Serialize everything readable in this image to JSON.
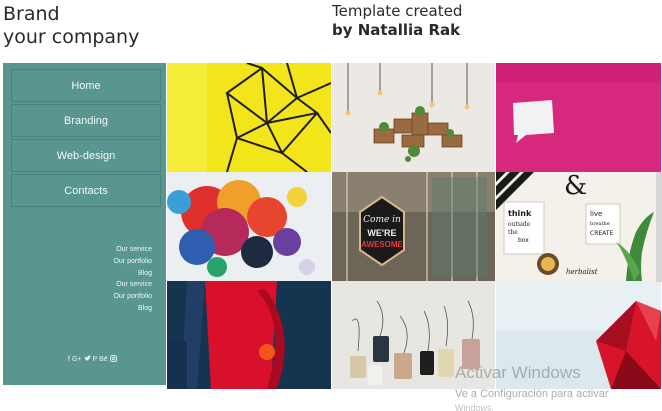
{
  "header": {
    "brand_line1": "Brand",
    "brand_line2": "your company",
    "credit_line1": "Template created",
    "credit_line2": "by Natallia Rak"
  },
  "sidebar": {
    "bg_color": "#5a9690",
    "nav": [
      "Home",
      "Branding",
      "Web-design",
      "Contacts"
    ],
    "links": [
      "Our service",
      "Our portfolio",
      "Blog",
      "Our service",
      "Our portfolio",
      "Blog"
    ],
    "social_icons": [
      {
        "name": "facebook-icon",
        "glyph": "f"
      },
      {
        "name": "google-plus-icon",
        "glyph": "G+"
      },
      {
        "name": "twitter-icon",
        "glyph": "🐦"
      },
      {
        "name": "pinterest-icon",
        "glyph": "P"
      },
      {
        "name": "behance-icon",
        "glyph": "Bē"
      },
      {
        "name": "instagram-icon",
        "glyph": "◎"
      }
    ]
  },
  "gallery": {
    "tiles": [
      "geometric-wire-on-yellow-image",
      "hanging-shelves-plants-image",
      "speech-bubble-on-pink-image",
      "colorful-ink-splash-image",
      "come-in-awesome-sign-image",
      "typography-desk-image",
      "red-abstract-painting-image",
      "gift-tags-image",
      "red-crystal-shape-image"
    ]
  },
  "watermark": {
    "line1": "Activar Windows",
    "line2": "Ve a Configuración para activar",
    "line3": "Windows."
  },
  "sign": {
    "top": "Come in",
    "mid": "WE'RE",
    "bottom": "AWESOME"
  },
  "typo": {
    "amp": "&",
    "w1": "think",
    "w2": "outside",
    "w3": "the",
    "w4": "box",
    "w5": "live",
    "w6": "breathe",
    "w7": "CREATE",
    "w8": "herbalist"
  }
}
